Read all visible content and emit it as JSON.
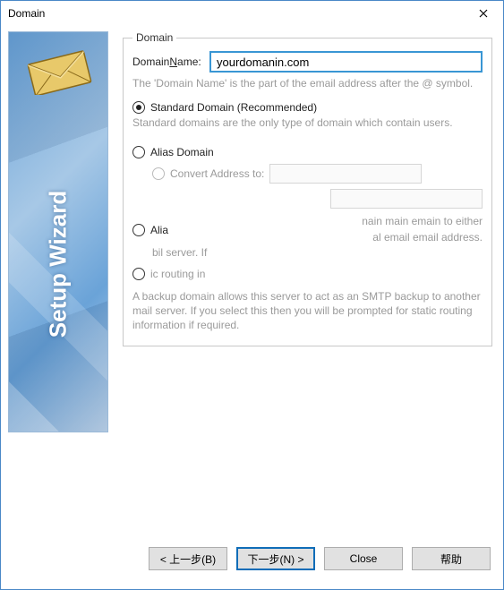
{
  "window": {
    "title": "Domain"
  },
  "sidebar": {
    "heading": "Setup Wizard"
  },
  "group": {
    "legend": "Domain",
    "domain_name_label_pre": "Domain ",
    "domain_name_label_accel": "N",
    "domain_name_label_post": "ame:",
    "domain_name_value": "yourdomanin.com",
    "domain_hint": "The 'Domain Name' is the part of the email address after the @ symbol.",
    "options": {
      "standard": {
        "label": "Standard Domain (Recommended)",
        "checked": true,
        "hint": "Standard domains are the only type of domain which contain users."
      },
      "alias": {
        "label": "Alias Domain",
        "checked": false,
        "convert_label": "Convert Address to:"
      },
      "alia_partial": {
        "label": "Alia",
        "checked": false
      },
      "routing_partial": {
        "label": "ic routing in",
        "checked": false
      }
    },
    "fragments": {
      "row1_right_a": "nain main emain to either",
      "row1_right_b": "al email email address.",
      "row2": "bil server. If"
    },
    "backup_paragraph": "A backup domain allows this server to act as an SMTP backup to another mail server. If you select this then you will be prompted for static routing information if required."
  },
  "buttons": {
    "back": "< 上一步(B)",
    "next": "下一步(N) >",
    "close": "Close",
    "help": "帮助"
  }
}
